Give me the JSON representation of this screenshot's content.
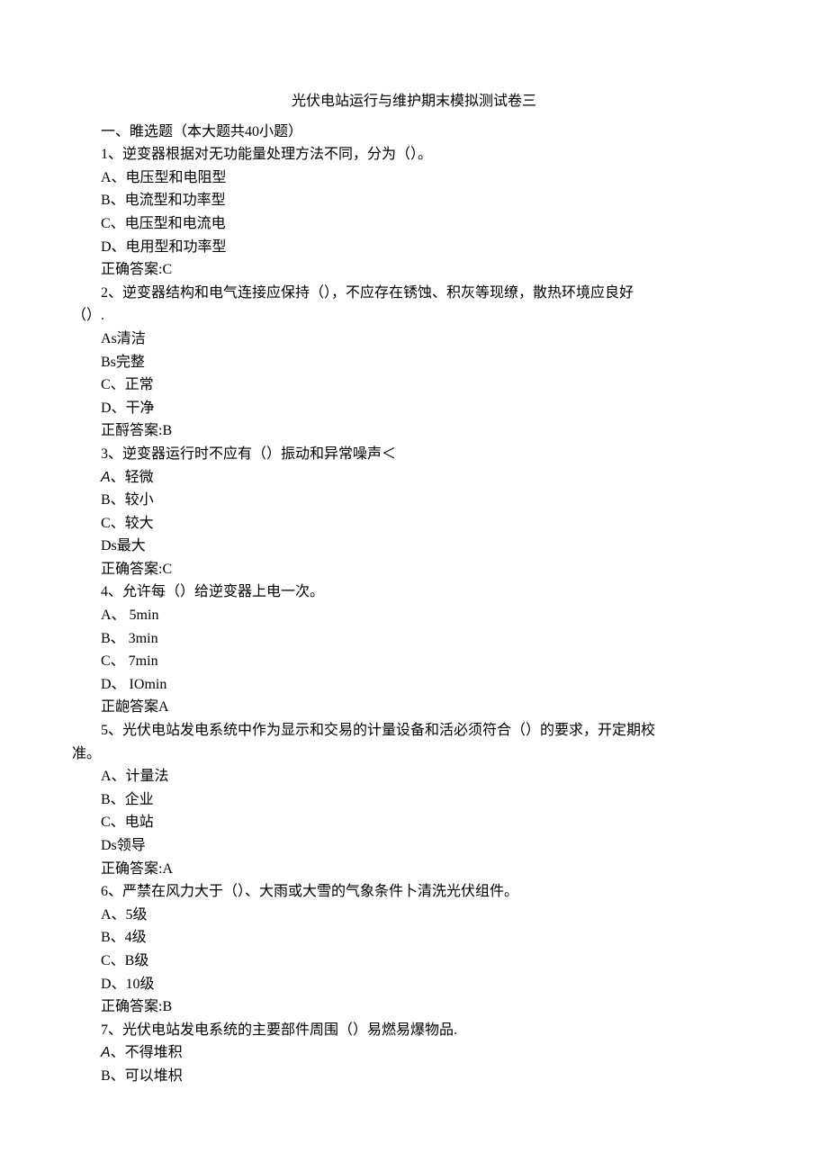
{
  "title": "光伏电站运行与维护期末模拟测试卷三",
  "section_header": "一、睢选题（本大题共40小题）",
  "q1": {
    "stem": "1、逆变器根据对无功能量处理方法不同，分为（）。",
    "a": "A、电压型和电阻型",
    "b": "B、电流型和功率型",
    "c": "C、电压型和电流电",
    "d": "D、电用型和功率型",
    "ans": "正确答案:C"
  },
  "q2": {
    "stem": "2、逆变器结构和电气连接应保持（），不应存在锈蚀、积灰等现缭，散热环境应良好",
    "stem2": "（）.",
    "a": "As清洁",
    "b": "Bs完整",
    "c": "C、正常",
    "d": "D、干净",
    "ans": "正酹答案:B"
  },
  "q3": {
    "stem": "3、逆变器运行时不应有（）振动和异常噪声＜",
    "a_prefix": "A",
    "a_suffix": "、轻微",
    "b": "B、较小",
    "c": "C、较大",
    "d": "Ds最大",
    "ans": "正确答案:C"
  },
  "q4": {
    "stem": "4、允许每（）给逆变器上电一次。",
    "a": "A、 5min",
    "b": "B、 3min",
    "c": "C、 7min",
    "d": "D、 IOmin",
    "ans": "正龅答案A"
  },
  "q5": {
    "stem": "5、光伏电站发电系统中作为显示和交易的计量设备和活必须符合（）的要求，开定期校",
    "stem2": "准。",
    "a": "A、计量法",
    "b": "B、企业",
    "c": "C、电站",
    "d": "Ds领导",
    "ans": "正确答案:A"
  },
  "q6": {
    "stem": "6、严禁在风力大于（）、大雨或大雪的气象条件卜清洗光伏组件。",
    "a": "A、5级",
    "b": "B、4级",
    "c": "C、B级",
    "d": "D、10级",
    "ans": "正确答案:B"
  },
  "q7": {
    "stem": "7、光伏电站发电系统的主要部件周围（）易燃易爆物品.",
    "a_prefix": "A",
    "a_suffix": "、不得堆积",
    "b": "B、可以堆枳"
  }
}
